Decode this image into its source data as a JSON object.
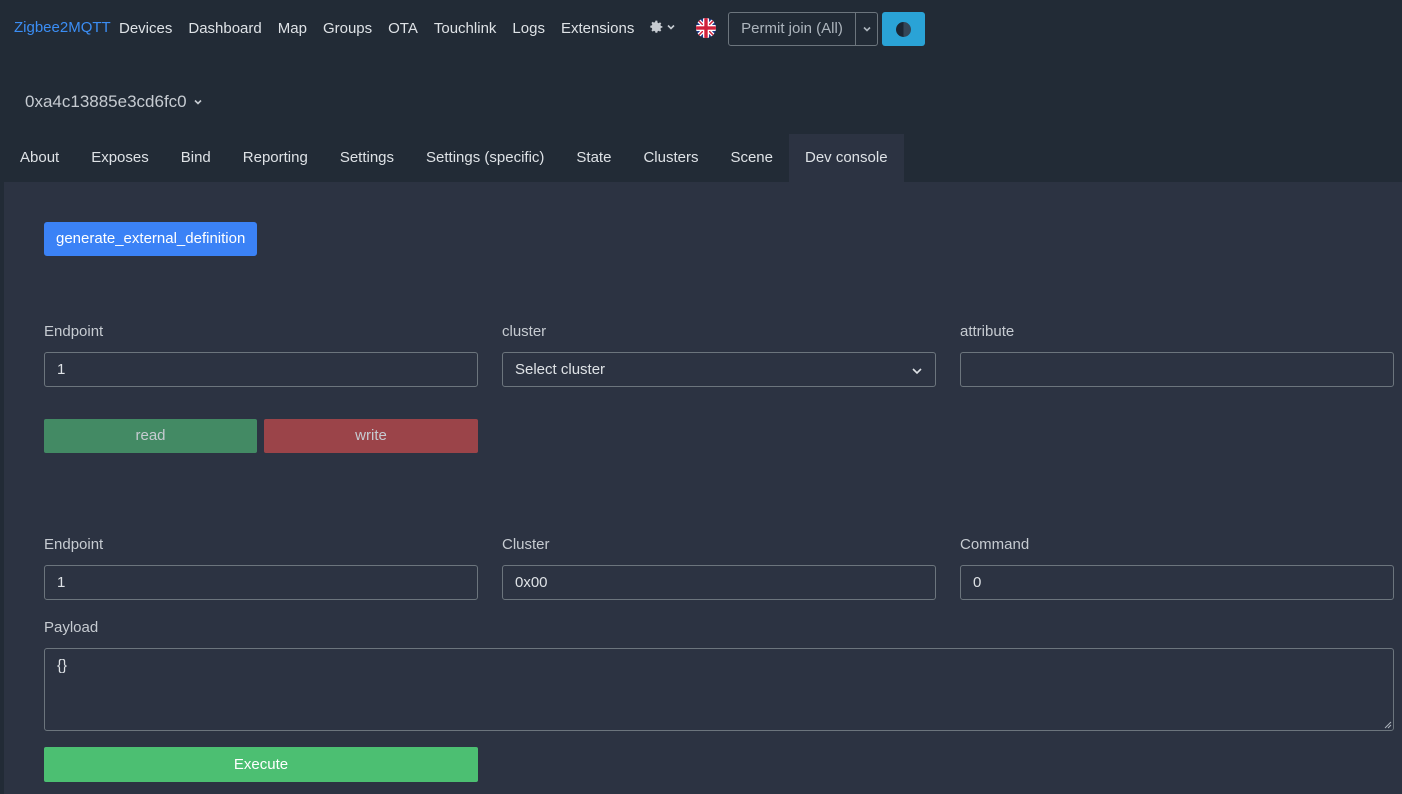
{
  "navbar": {
    "brand": "Zigbee2MQTT",
    "links": [
      "Devices",
      "Dashboard",
      "Map",
      "Groups",
      "OTA",
      "Touchlink",
      "Logs",
      "Extensions"
    ],
    "settings_icon": "gear-icon",
    "language_icon": "uk-flag-icon",
    "permit_join_label": "Permit join (All)",
    "theme_icon": "theme-toggle-icon"
  },
  "device": {
    "title": "0xa4c13885e3cd6fc0"
  },
  "tabs": [
    "About",
    "Exposes",
    "Bind",
    "Reporting",
    "Settings",
    "Settings (specific)",
    "State",
    "Clusters",
    "Scene",
    "Dev console"
  ],
  "active_tab": "Dev console",
  "dev_console": {
    "generate_button": "generate_external_definition",
    "read_section": {
      "endpoint_label": "Endpoint",
      "endpoint_value": "1",
      "cluster_label": "cluster",
      "cluster_placeholder": "Select cluster",
      "attribute_label": "attribute",
      "attribute_value": "",
      "read_button": "read",
      "write_button": "write"
    },
    "command_section": {
      "endpoint_label": "Endpoint",
      "endpoint_value": "1",
      "cluster_label": "Cluster",
      "cluster_value": "0x00",
      "command_label": "Command",
      "command_value": "0",
      "payload_label": "Payload",
      "payload_value": "{}",
      "execute_button": "Execute"
    }
  },
  "colors": {
    "background": "#222b36",
    "panel": "#2c3342",
    "brand": "#3b8ef5",
    "primary": "#3b82f6",
    "read": "#438a64",
    "write": "#9b4449",
    "execute": "#4cbf72",
    "theme_button": "#2aa3d6"
  }
}
